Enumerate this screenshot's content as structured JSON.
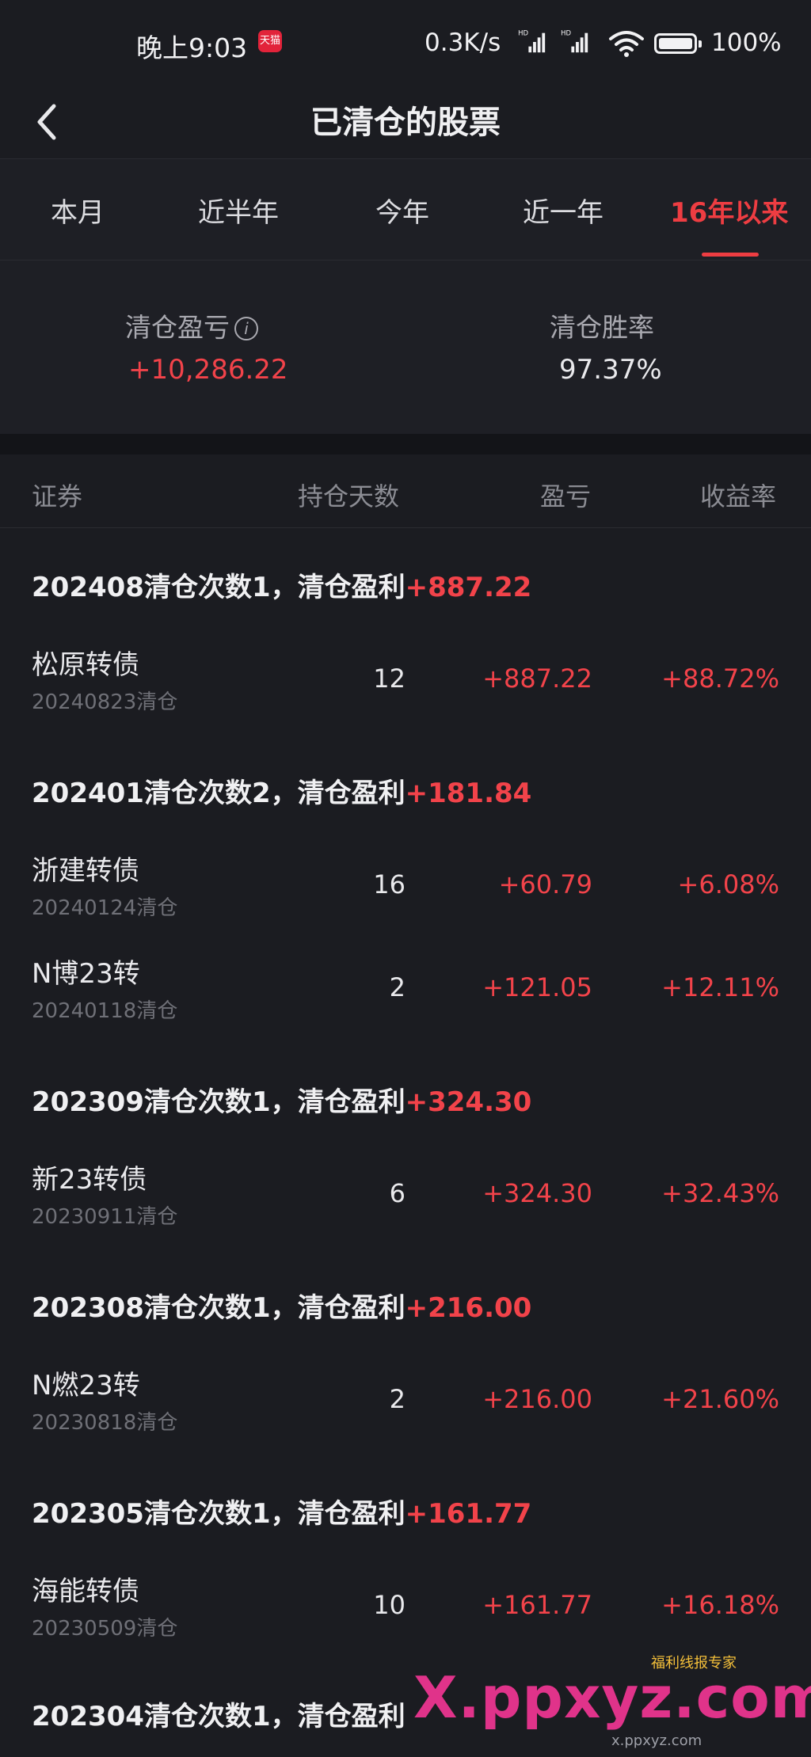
{
  "status_bar": {
    "time": "晚上9:03",
    "app_badge": "天猫",
    "network_speed": "0.3K/s",
    "battery": "100%"
  },
  "nav": {
    "title": "已清仓的股票"
  },
  "tabs": [
    {
      "label": "本月",
      "active": false
    },
    {
      "label": "近半年",
      "active": false
    },
    {
      "label": "今年",
      "active": false
    },
    {
      "label": "近一年",
      "active": false
    },
    {
      "label": "16年以来",
      "active": true
    }
  ],
  "summary": {
    "pl_label": "清仓盈亏",
    "pl_value": "+10,286.22",
    "winrate_label": "清仓胜率",
    "winrate_value": "97.37%"
  },
  "table_header": {
    "security": "证券",
    "days": "持仓天数",
    "pl": "盈亏",
    "rate": "收益率"
  },
  "groups": [
    {
      "title": "202408清仓次数1，清仓盈利",
      "amount": "+887.22",
      "rows": [
        {
          "name": "松原转债",
          "date": "20240823清仓",
          "days": "12",
          "pl": "+887.22",
          "rate": "+88.72%"
        }
      ]
    },
    {
      "title": "202401清仓次数2，清仓盈利",
      "amount": "+181.84",
      "rows": [
        {
          "name": "浙建转债",
          "date": "20240124清仓",
          "days": "16",
          "pl": "+60.79",
          "rate": "+6.08%"
        },
        {
          "name": "N博23转",
          "date": "20240118清仓",
          "days": "2",
          "pl": "+121.05",
          "rate": "+12.11%"
        }
      ]
    },
    {
      "title": "202309清仓次数1，清仓盈利",
      "amount": "+324.30",
      "rows": [
        {
          "name": "新23转债",
          "date": "20230911清仓",
          "days": "6",
          "pl": "+324.30",
          "rate": "+32.43%"
        }
      ]
    },
    {
      "title": "202308清仓次数1，清仓盈利",
      "amount": "+216.00",
      "rows": [
        {
          "name": "N燃23转",
          "date": "20230818清仓",
          "days": "2",
          "pl": "+216.00",
          "rate": "+21.60%"
        }
      ]
    },
    {
      "title": "202305清仓次数1，清仓盈利",
      "amount": "+161.77",
      "rows": [
        {
          "name": "海能转债",
          "date": "20230509清仓",
          "days": "10",
          "pl": "+161.77",
          "rate": "+16.18%"
        }
      ]
    },
    {
      "title": "202304清仓次数1，清仓盈利",
      "amount": "",
      "rows": []
    }
  ],
  "watermark": {
    "brand": "X.ppxyz.com",
    "sub": "福利线报专家",
    "url": "x.ppxyz.com"
  },
  "colors": {
    "accent_red": "#f2434a",
    "background": "#1b1c21"
  }
}
